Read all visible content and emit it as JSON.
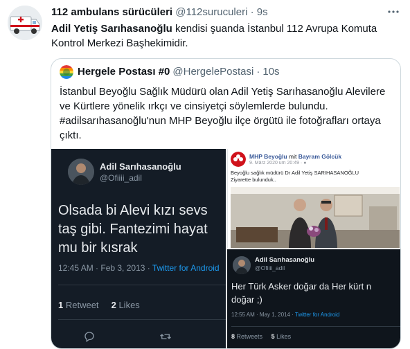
{
  "tweet": {
    "author_name": "112 ambulans sürücüleri",
    "author_handle": "@112suruculeri",
    "separator": "·",
    "time": "9s",
    "mention": "Adil Yetiş Sarıhasanoğlu",
    "text_line1_rest": " kendisi şuanda İstanbul 112 Avrupa Komuta",
    "text_line2": "Kontrol Merkezi Başhekimidir.",
    "more_icon": "ellipsis-icon"
  },
  "quote": {
    "author_name": "Hergele Postası #0",
    "author_handle": "@HergelePostasi",
    "separator": "·",
    "time": "10s",
    "text_lines": [
      "İstanbul Beyoğlu Sağlık Müdürü olan Adil Yetiş Sarıhasanoğlu Alevilere",
      "ve  Kürtlere yönelik ırkçı ve cinsiyetçi söylemlerde bulundu.",
      "#adilsarıhasanoğlu'nun MHP Beyoğlu ilçe örgütü ile fotoğrafları ortaya",
      "çıktı."
    ]
  },
  "media": {
    "left_tweet": {
      "name": "Adil Sarıhasanoğlu",
      "handle": "@Ofiiii_adil",
      "body": "Olsada bi Alevi kızı sevs\ntaş gibi. Fantezimi hayat\nmu bir kısrak",
      "timestamp": "12:45 AM · Feb 3, 2013 · ",
      "via": "Twitter for Android",
      "retweet_count": "1",
      "retweet_label": " Retweet",
      "like_count": "2",
      "like_label": " Likes"
    },
    "facebook_post": {
      "page_name": "MHP Beyoğlu",
      "with_text": " mit ",
      "with_person": "Bayram Gölcük",
      "date": "9. März 2020 um 20:49 · ",
      "text": "Beyoğlu sağlık müdürü Dr Adil Yetiş SARIHASANOĞLU\nZiyarette bulunduk.."
    },
    "bottom_right_tweet": {
      "name": "Adil Sarıhasanoğlu",
      "handle": "@Ofiiii_adil",
      "body": "Her Türk Asker doğar da Her kürt n\ndoğar ;)",
      "timestamp": "12:55 AM · May 1, 2014 · ",
      "via": "Twitter for Android",
      "retweet_count": "8",
      "retweet_label": " Retweets",
      "like_count": "5",
      "like_label": " Likes"
    }
  },
  "colors": {
    "text_primary": "#0f1419",
    "text_secondary": "#536471",
    "border": "#cfd9de",
    "dark_bg": "#141c26",
    "link_blue": "#1d9bf0",
    "fb_blue": "#385898",
    "mhp_red": "#d0121b"
  }
}
